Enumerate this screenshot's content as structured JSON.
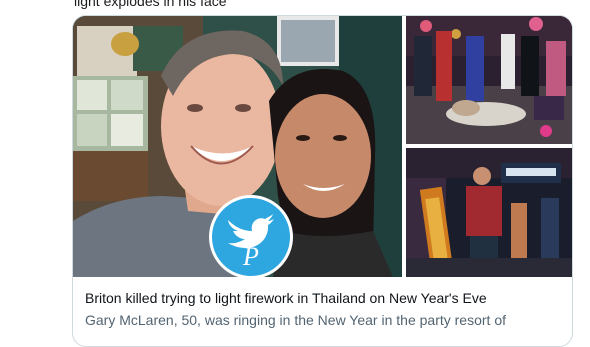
{
  "tweet": {
    "text_tail": "light explodes in his face"
  },
  "link_card": {
    "headline": "Briton killed trying to light firework in Thailand on New Year's Eve",
    "description": "Gary McLaren, 50, was ringing in the New Year in the party resort of",
    "images": [
      "main-couple-photo",
      "street-scene-photo",
      "night-street-photo"
    ],
    "watermark": {
      "icon": "twitter-bird-icon",
      "letter": "P"
    }
  },
  "colors": {
    "card_border": "#cfd9de",
    "headline": "#0f1419",
    "description": "#536471",
    "watermark_blue": "#2ea7e0"
  }
}
